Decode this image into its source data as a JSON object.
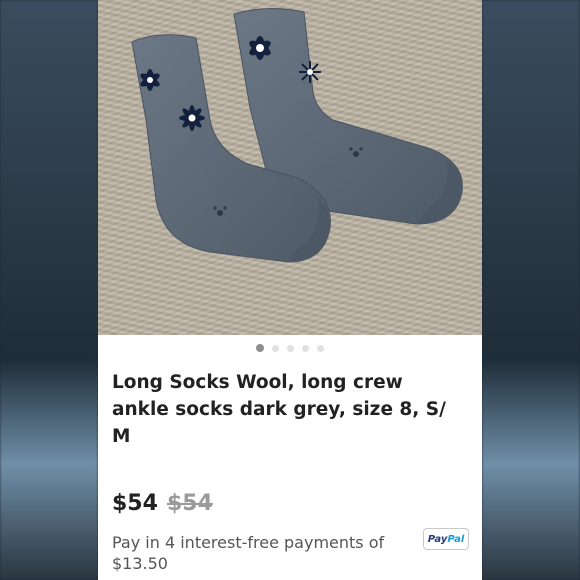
{
  "listing": {
    "title": "Long Socks Wool, long crew ankle socks dark grey, size 8, S/ M",
    "price": "$54",
    "original_price": "$54",
    "installment_text": "Pay in 4 interest-free payments of $13.50",
    "paypal_logo": {
      "part1": "Pay",
      "part2": "Pal"
    }
  },
  "carousel": {
    "count": 5,
    "active_index": 0
  },
  "colors": {
    "sock": "#5e6a78",
    "carpet": "#b9b09f",
    "title_text": "#222222",
    "strike_price": "#9a9a9a",
    "paypal_dark": "#253b80",
    "paypal_light": "#179bd7"
  }
}
